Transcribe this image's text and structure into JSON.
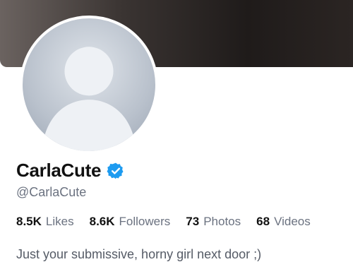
{
  "profile": {
    "name": "CarlaCute",
    "handle": "@CarlaCute",
    "verified_icon": "verified-badge-icon",
    "bio": "Just your submissive, horny girl next door ;)",
    "stats": [
      {
        "value": "8.5K",
        "label": "Likes"
      },
      {
        "value": "8.6K",
        "label": "Followers"
      },
      {
        "value": "73",
        "label": "Photos"
      },
      {
        "value": "68",
        "label": "Videos"
      }
    ]
  },
  "colors": {
    "verified": "#1d9bf0",
    "name": "#111111",
    "muted": "#6b7280"
  }
}
